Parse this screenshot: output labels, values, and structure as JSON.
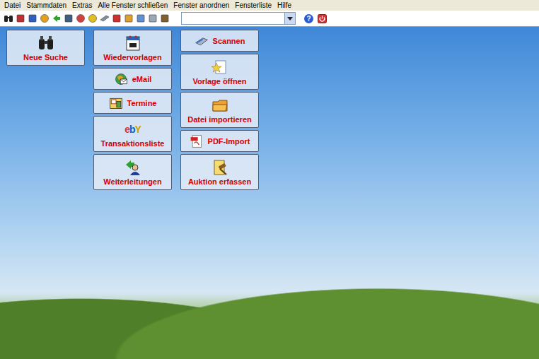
{
  "menu": [
    {
      "label": "Datei"
    },
    {
      "label": "Stammdaten"
    },
    {
      "label": "Extras"
    },
    {
      "label": "Alle Fenster schließen"
    },
    {
      "label": "Fenster anordnen"
    },
    {
      "label": "Fensterliste"
    },
    {
      "label": "Hilfe"
    }
  ],
  "toolbar": {
    "help_icon": "?"
  },
  "columns": [
    [
      {
        "label": "Neue Suche",
        "kind": "tall"
      }
    ],
    [
      {
        "label": "Wiedervorlagen",
        "kind": "tall"
      },
      {
        "label": "eMail",
        "kind": "wide"
      },
      {
        "label": "Termine",
        "kind": "wide"
      },
      {
        "label": "Transaktionsliste",
        "kind": "tall",
        "logo": "ebY"
      },
      {
        "label": "Weiterleitungen",
        "kind": "tall"
      }
    ],
    [
      {
        "label": "Scannen",
        "kind": "wide"
      },
      {
        "label": "Vorlage öffnen",
        "kind": "tall"
      },
      {
        "label": "Datei importieren",
        "kind": "tall"
      },
      {
        "label": "PDF-Import",
        "kind": "wide"
      },
      {
        "label": "Auktion erfassen",
        "kind": "tall"
      }
    ]
  ]
}
